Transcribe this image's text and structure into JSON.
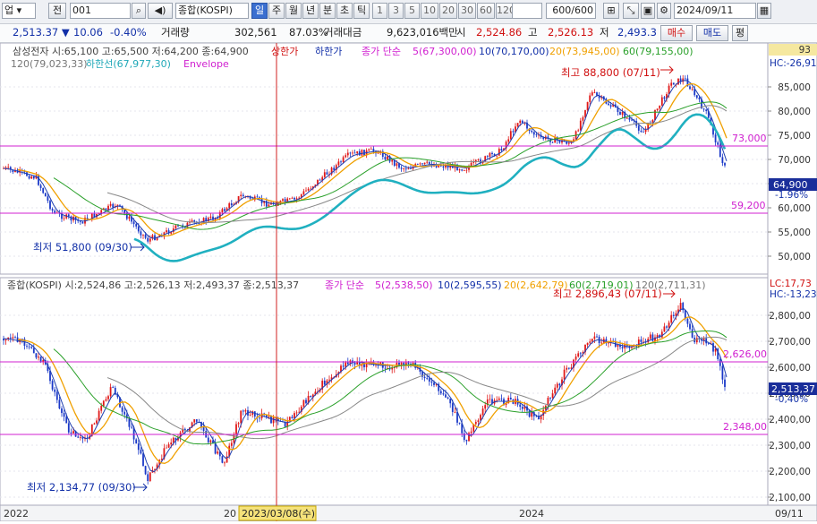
{
  "toolbar": {
    "market": "업",
    "prev": "전",
    "code": "001",
    "name": "종합(KOSPI)",
    "periods": [
      "일",
      "주",
      "월",
      "년",
      "분",
      "초",
      "틱"
    ],
    "active_period": "일",
    "intervals": [
      "1",
      "3",
      "5",
      "10",
      "20",
      "30",
      "60",
      "120"
    ],
    "count": "600/600",
    "date": "2024/09/11"
  },
  "infobar": {
    "price": "2,513.37",
    "change": "10.06",
    "change_pct": "-0.40%",
    "volume_label": "거래량",
    "volume": "302,561",
    "volume_pct": "87.03%",
    "amount_label": "거래대금",
    "amount": "9,623,016백만",
    "open_label": "시",
    "open": "2,524.86",
    "high_label": "고",
    "high": "2,526.13",
    "low_label": "저",
    "low": "2,493.3",
    "buy": "매수",
    "sell": "매도",
    "eval": "평"
  },
  "top_panel": {
    "legend_line1": {
      "stock": "삼성전자 시:65,100 고:65,500 저:64,200 종:64,900",
      "upper": "상한가",
      "lower": "하한가",
      "ma_type": "종가 단순",
      "ma5": "5(67,300,00)",
      "ma10": "10(70,170,00)",
      "ma20": "20(73,945,00)",
      "ma60": "60(79,155,00)"
    },
    "legend_line2": {
      "ma120": "120(79,023,33)",
      "lower_band": "하한선(67,977,30)",
      "envelope": "Envelope"
    },
    "annot_high": "최고 88,800 (07/11)",
    "annot_low": "최저 51,800 (09/30)",
    "line_upper_label": "73,000",
    "line_lower_label": "59,200",
    "current_label": "64,900",
    "current_pct": "-1.96%",
    "corner_top": "93",
    "hc_label": "HC:-26,91",
    "y_ticks": [
      "85,000",
      "80,000",
      "75,000",
      "70,000",
      "65,000",
      "60,000",
      "55,000",
      "50,000"
    ]
  },
  "bottom_panel": {
    "legend": {
      "index": "종합(KOSPI) 시:2,524,86 고:2,526,13 저:2,493,37 종:2,513,37",
      "ma_type": "종가 단순",
      "ma5": "5(2,538,50)",
      "ma10": "10(2,595,55)",
      "ma20": "20(2,642,79)",
      "ma60": "60(2,719,01)",
      "ma120": "120(2,711,31)"
    },
    "annot_high": "최고 2,896,43 (07/11)",
    "annot_low": "최저 2,134,77 (09/30)",
    "line_upper_label": "2,626,00",
    "line_lower_label": "2,348,00",
    "current_label": "2,513,37",
    "current_pct": "-0,40%",
    "lc_label": "LC:17,73",
    "hc_label": "HC:-13,23",
    "y_ticks": [
      "2,800,00",
      "2,700,00",
      "2,600,00",
      "2,500,00",
      "2,400,00",
      "2,300,00",
      "2,200,00",
      "2,100,00"
    ]
  },
  "xaxis": {
    "labels": [
      "2022",
      "2023/03/08(수)",
      "2024"
    ],
    "label_hidden": "20",
    "right": "09/11"
  },
  "chart_data": [
    {
      "type": "line",
      "title": "삼성전자",
      "series": [
        {
          "name": "5",
          "color": "#2040b0"
        },
        {
          "name": "20",
          "color": "#f0a000"
        },
        {
          "name": "60",
          "color": "#2aa02a"
        },
        {
          "name": "120",
          "color": "#888888"
        },
        {
          "name": "하한선",
          "color": "#20b0c0"
        }
      ],
      "ylim": [
        47000,
        91000
      ],
      "reference_lines": [
        73000,
        59200
      ],
      "high": 88800,
      "low": 51800,
      "close": 64900
    },
    {
      "type": "line",
      "title": "종합(KOSPI)",
      "series": [
        {
          "name": "5",
          "color": "#2040b0"
        },
        {
          "name": "20",
          "color": "#f0a000"
        },
        {
          "name": "60",
          "color": "#2aa02a"
        },
        {
          "name": "120",
          "color": "#888888"
        }
      ],
      "ylim": [
        2070,
        2920
      ],
      "reference_lines": [
        2626,
        2348
      ],
      "high": 2896.43,
      "low": 2134.77,
      "close": 2513.37
    }
  ],
  "colors": {
    "upper_line": "#d020d0",
    "cursor": "#d02020",
    "up_candle": "#e01818",
    "down_candle": "#1a38c8"
  }
}
